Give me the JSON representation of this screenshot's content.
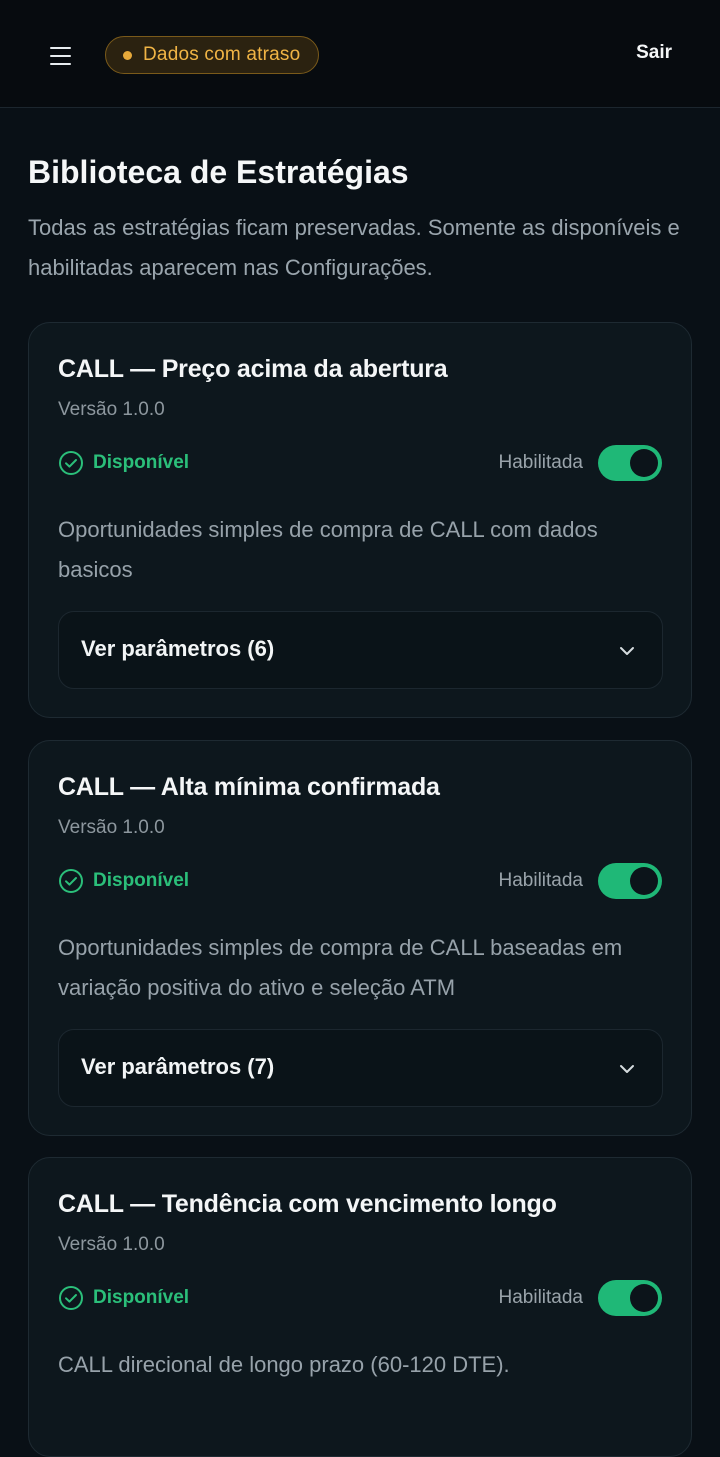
{
  "header": {
    "menu_icon": "hamburger-menu-icon",
    "status_badge": "Dados com atraso",
    "status_color": "#e7a93a",
    "logout_label": "Sair"
  },
  "page": {
    "title": "Biblioteca de Estratégias",
    "subtitle": "Todas as estratégias ficam preservadas. Somente as disponíveis e habilitadas aparecem nas Configurações."
  },
  "colors": {
    "accent_green": "#1fb877",
    "status_green": "#2bbf7a",
    "background": "#091016",
    "card": "#0d171d"
  },
  "strategies": [
    {
      "title": "CALL — Preço acima da abertura",
      "version": "Versão 1.0.0",
      "status": "Disponível",
      "status_icon": "check-circle-icon",
      "enabled_label": "Habilitada",
      "enabled": true,
      "description": "Oportunidades simples de compra de CALL com dados basicos",
      "params_label": "Ver parâmetros (6)"
    },
    {
      "title": "CALL — Alta mínima confirmada",
      "version": "Versão 1.0.0",
      "status": "Disponível",
      "status_icon": "check-circle-icon",
      "enabled_label": "Habilitada",
      "enabled": true,
      "description": "Oportunidades simples de compra de CALL baseadas em variação positiva do ativo e seleção ATM",
      "params_label": "Ver parâmetros (7)"
    },
    {
      "title": "CALL — Tendência com vencimento longo",
      "version": "Versão 1.0.0",
      "status": "Disponível",
      "status_icon": "check-circle-icon",
      "enabled_label": "Habilitada",
      "enabled": true,
      "description": "CALL direcional de longo prazo (60-120 DTE)."
    }
  ]
}
